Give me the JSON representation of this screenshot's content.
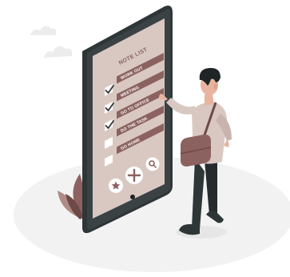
{
  "app": {
    "title": "NOTE LIST"
  },
  "items": [
    {
      "label": "WORK OUT",
      "checked": true
    },
    {
      "label": "MEETING",
      "checked": true
    },
    {
      "label": "GO TO OFFICE",
      "checked": true
    },
    {
      "label": "DO THE TASK",
      "checked": false
    },
    {
      "label": "GO HOME",
      "checked": false
    }
  ],
  "toolbar": {
    "buttons": [
      {
        "icon": "star-icon"
      },
      {
        "icon": "plus-icon"
      },
      {
        "icon": "search-icon"
      }
    ]
  },
  "colors": {
    "phone_body": "#2f3638",
    "screen": "#d9c8c2",
    "item_bar": "#8b625f",
    "checkbox": "#ffffff",
    "accent": "#9c6b66",
    "ground": "#f2f2f2"
  }
}
